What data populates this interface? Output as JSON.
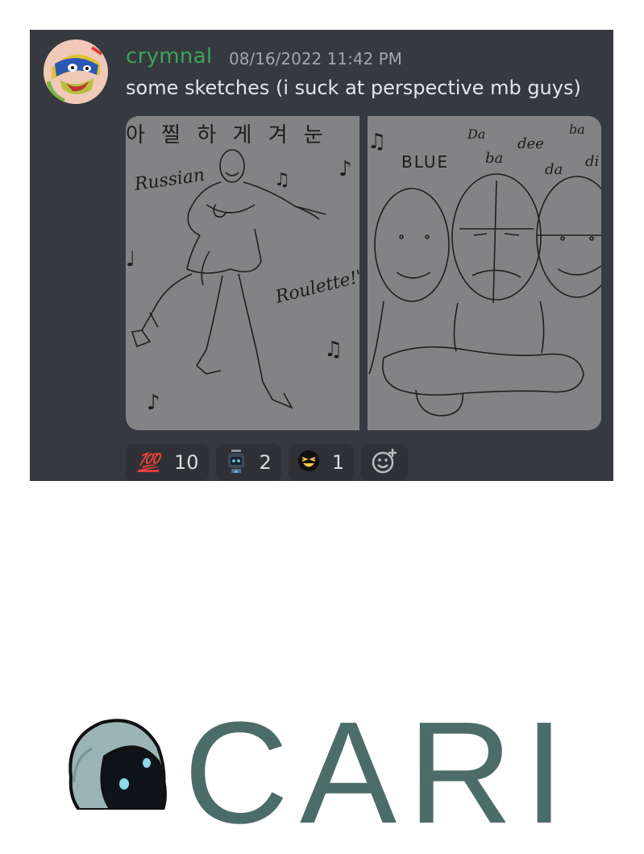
{
  "message": {
    "username": "crymnal",
    "timestamp": "08/16/2022 11:42 PM",
    "text": "some sketches (i suck at perspective mb guys)",
    "avatar_icon": "user-avatar-icon"
  },
  "attachments": {
    "left_sketch": {
      "text_korean": "아 찔 하 게 겨 눈",
      "text_russian": "Russian",
      "text_roulette": "Roulette!\"",
      "notes": [
        "♫",
        "♪",
        "♩",
        "♫",
        "♪"
      ]
    },
    "right_sketch": {
      "text_blue": "BLUE",
      "text_da": "Da",
      "text_dee": "dee",
      "text_ba1": "ba",
      "text_ba2": "ba",
      "text_da2": "da",
      "text_di": "di",
      "notes": [
        "♫"
      ]
    }
  },
  "reactions": [
    {
      "emoji": "💯",
      "icon": "hundred-points-icon",
      "count": "10"
    },
    {
      "emoji": "",
      "icon": "robot-icon",
      "count": "2"
    },
    {
      "emoji": "",
      "icon": "laughing-face-icon",
      "count": "1"
    }
  ],
  "add_reaction_icon": "add-reaction-icon",
  "footer": {
    "brand_text": "CARI",
    "logo_icon": "robot-mascot-icon"
  },
  "colors": {
    "card_bg": "#36393f",
    "username": "#3ba55c",
    "timestamp": "#a3a6aa",
    "text": "#e3e5e8",
    "reaction_bg": "#2f3136",
    "sketch_bg": "#838385",
    "brand": "#4c6c68"
  }
}
